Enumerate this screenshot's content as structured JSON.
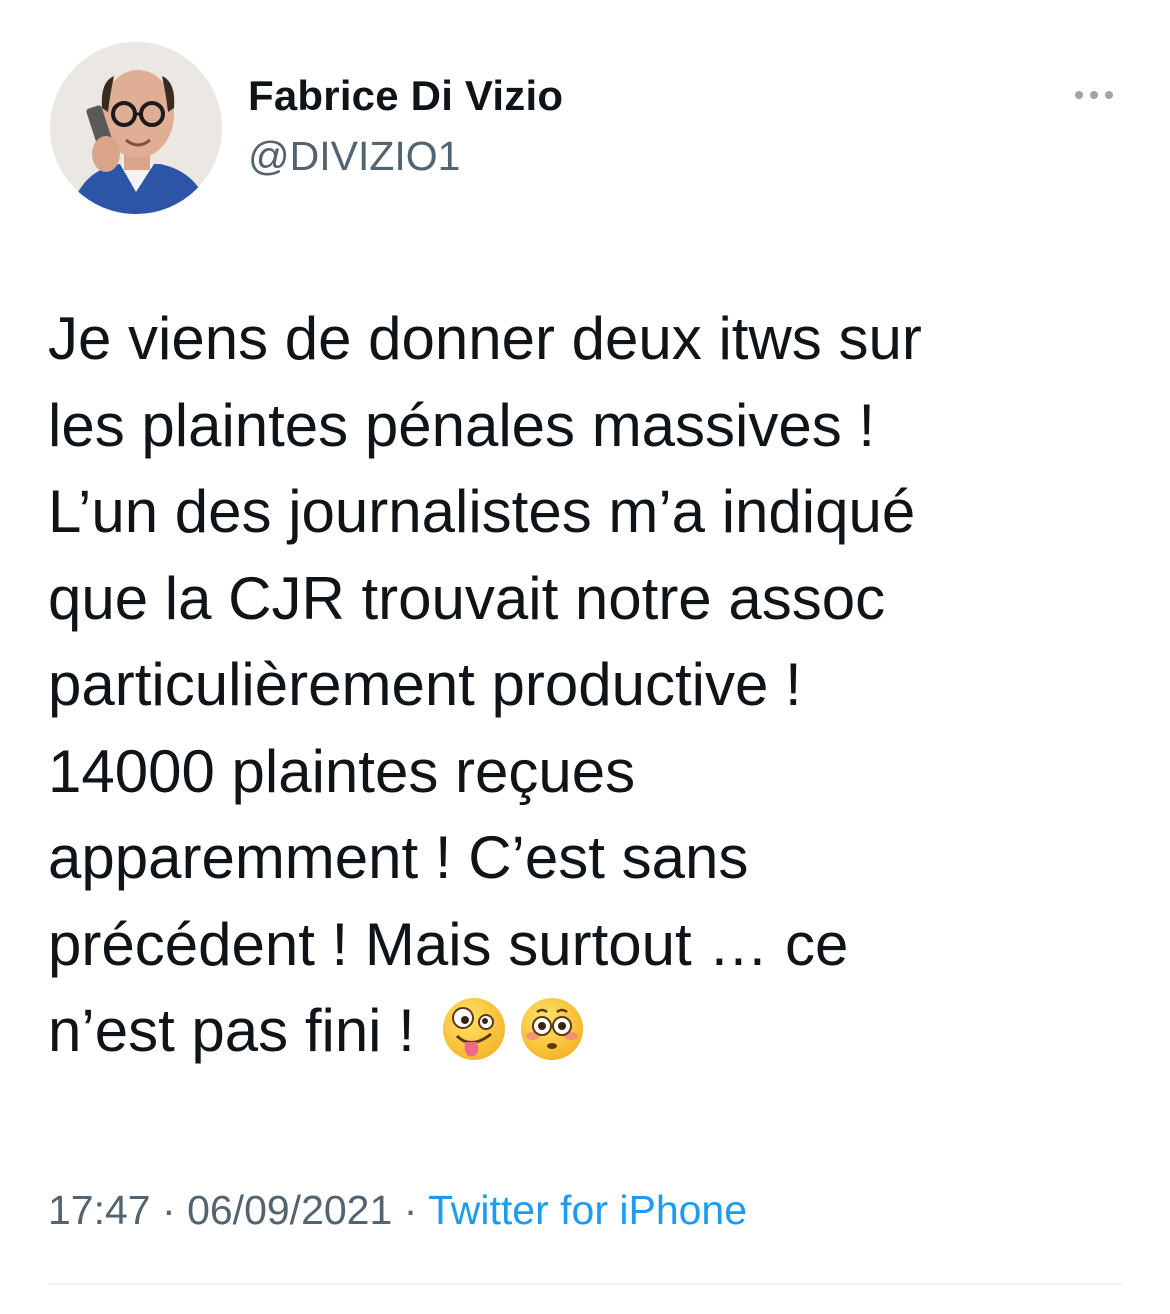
{
  "author": {
    "display_name": "Fabrice Di Vizio",
    "handle": "@DIVIZIO1"
  },
  "icons": {
    "more": "more-horizontal-icon",
    "emoji_1": "zany-face-emoji",
    "emoji_2": "flushed-face-emoji"
  },
  "tweet": {
    "lines": [
      "Je viens de donner deux itws sur",
      "les plaintes pénales massives !",
      "L’un des journalistes m’a indiqué",
      "que la CJR trouvait notre assoc",
      "particulièrement productive !",
      "14000 plaintes reçues",
      "apparemment ! C’est sans",
      "précédent ! Mais surtout … ce",
      "n’est pas fini !"
    ]
  },
  "meta": {
    "time": "17:47",
    "separator": "·",
    "date": "06/09/2021",
    "source": "Twitter for iPhone"
  },
  "colors": {
    "text": "#0f1419",
    "secondary": "#536471",
    "link": "#1d9bf0",
    "divider": "#eff3f4"
  }
}
